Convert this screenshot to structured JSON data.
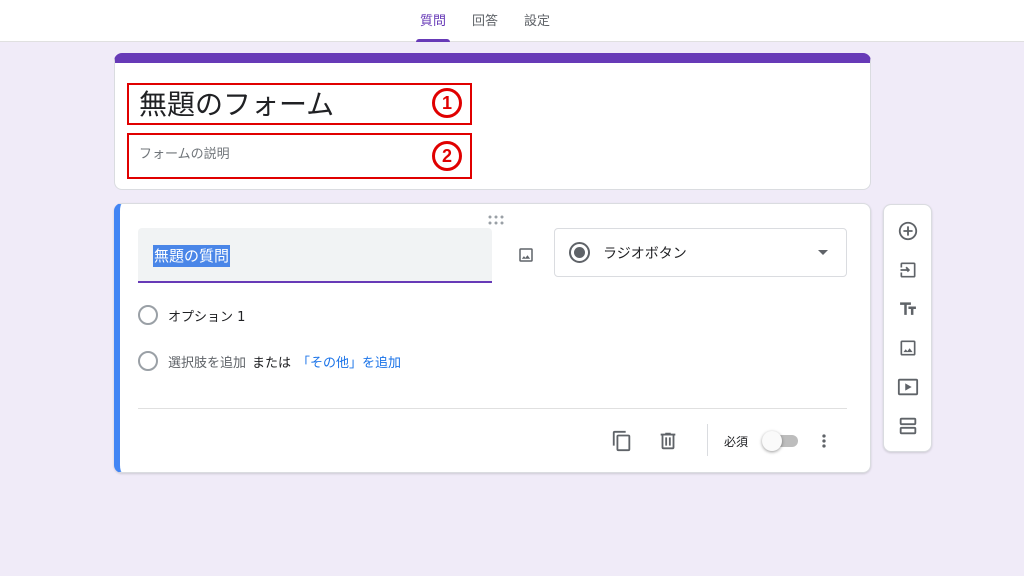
{
  "tabs": [
    {
      "label": "質問",
      "active": true
    },
    {
      "label": "回答",
      "active": false
    },
    {
      "label": "設定",
      "active": false
    }
  ],
  "form": {
    "title": "無題のフォーム",
    "description_placeholder": "フォームの説明",
    "title_marker": "1",
    "description_marker": "2"
  },
  "question": {
    "title": "無題の質問",
    "type_label": "ラジオボタン",
    "options": [
      "オプション 1"
    ],
    "add_option": "選択肢を追加",
    "or_text": "または",
    "add_other": "「その他」を追加",
    "required_label": "必須",
    "required": false
  },
  "colors": {
    "accent": "#673ab7",
    "active_card": "#4285f4",
    "background": "#f0ebf8",
    "annotation": "#e00000",
    "link": "#1a73e8"
  },
  "icons": {
    "image": "image-icon",
    "copy": "copy-icon",
    "delete": "trash-icon",
    "more": "more-vert-icon",
    "add_question": "add-circle-icon",
    "import": "import-icon",
    "title_text": "title-text-icon",
    "add_image": "image-icon",
    "add_video": "video-icon",
    "add_section": "section-icon"
  }
}
